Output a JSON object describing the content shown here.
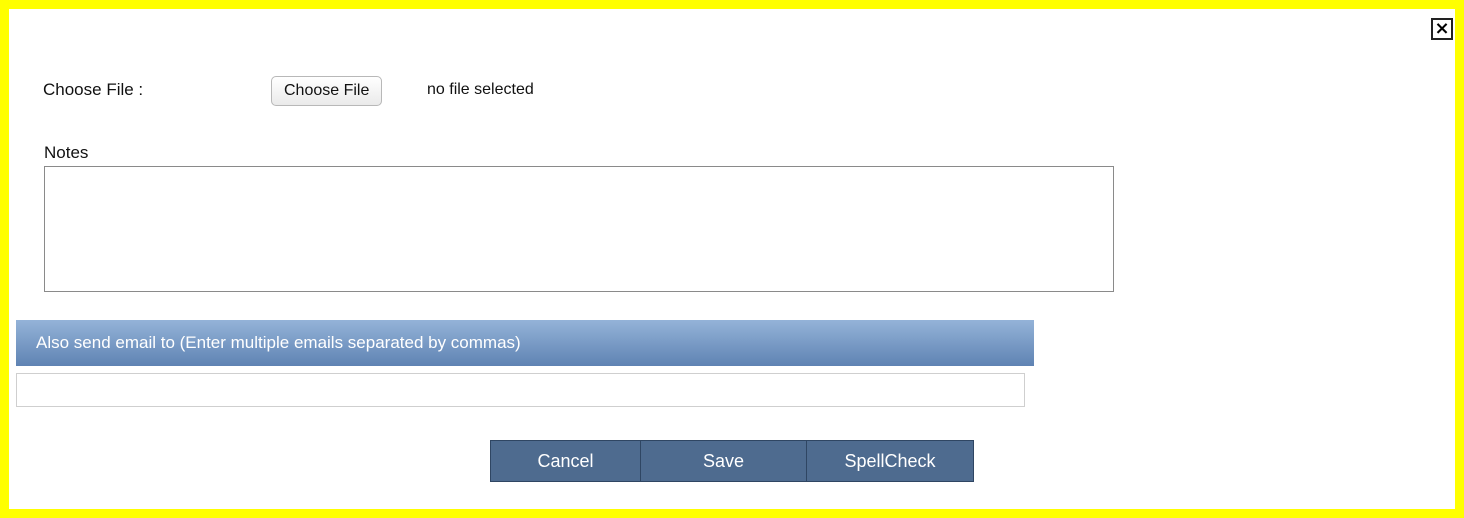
{
  "dialog": {
    "close_label": "×"
  },
  "file": {
    "label": "Choose File :",
    "button_label": "Choose File",
    "status": "no file selected"
  },
  "notes": {
    "label": "Notes",
    "value": ""
  },
  "email": {
    "header": "Also send email to (Enter multiple emails separated by commas)",
    "value": ""
  },
  "actions": {
    "cancel_label": "Cancel",
    "save_label": "Save",
    "spellcheck_label": "SpellCheck"
  },
  "colors": {
    "frame_border": "#ffff00",
    "header_gradient_top": "#94b3d8",
    "header_gradient_bottom": "#5f83b3",
    "button_bg": "#4e6b8f"
  }
}
